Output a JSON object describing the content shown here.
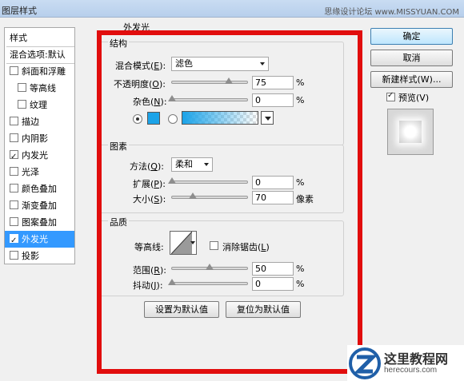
{
  "window": {
    "title": "图层样式",
    "watermark": "思缘设计论坛 www.MISSYUAN.COM"
  },
  "sidebar": {
    "items": [
      {
        "label": "样式",
        "checkbox": false,
        "checked": false,
        "selected": false,
        "indent": false
      },
      {
        "label": "混合选项:默认",
        "checkbox": false,
        "checked": false,
        "selected": false,
        "indent": false
      },
      {
        "label": "斜面和浮雕",
        "checkbox": true,
        "checked": false,
        "selected": false,
        "indent": false
      },
      {
        "label": "等高线",
        "checkbox": true,
        "checked": false,
        "selected": false,
        "indent": true
      },
      {
        "label": "纹理",
        "checkbox": true,
        "checked": false,
        "selected": false,
        "indent": true
      },
      {
        "label": "描边",
        "checkbox": true,
        "checked": false,
        "selected": false,
        "indent": false
      },
      {
        "label": "内阴影",
        "checkbox": true,
        "checked": false,
        "selected": false,
        "indent": false
      },
      {
        "label": "内发光",
        "checkbox": true,
        "checked": true,
        "selected": false,
        "indent": false
      },
      {
        "label": "光泽",
        "checkbox": true,
        "checked": false,
        "selected": false,
        "indent": false
      },
      {
        "label": "颜色叠加",
        "checkbox": true,
        "checked": false,
        "selected": false,
        "indent": false
      },
      {
        "label": "渐变叠加",
        "checkbox": true,
        "checked": false,
        "selected": false,
        "indent": false
      },
      {
        "label": "图案叠加",
        "checkbox": true,
        "checked": false,
        "selected": false,
        "indent": false
      },
      {
        "label": "外发光",
        "checkbox": true,
        "checked": true,
        "selected": true,
        "indent": false
      },
      {
        "label": "投影",
        "checkbox": true,
        "checked": false,
        "selected": false,
        "indent": false
      }
    ]
  },
  "panel": {
    "title": "外发光",
    "structure": {
      "title": "结构",
      "blend_mode_label": "混合模式(",
      "blend_mode_key": "E",
      "blend_mode_value": "滤色",
      "opacity_label": "不透明度(",
      "opacity_key": "O",
      "opacity_value": "75",
      "opacity_fraction": 0.75,
      "noise_label": "杂色(",
      "noise_key": "N",
      "noise_value": "0",
      "noise_fraction": 0,
      "color": "#1ba3e8"
    },
    "elements": {
      "title": "图素",
      "technique_label": "方法(",
      "technique_key": "Q",
      "technique_value": "柔和",
      "spread_label": "扩展(",
      "spread_key": "P",
      "spread_value": "0",
      "spread_fraction": 0,
      "size_label": "大小(",
      "size_key": "S",
      "size_value": "70",
      "size_unit": "像素",
      "size_fraction": 0.28
    },
    "quality": {
      "title": "品质",
      "contour_label": "等高线:",
      "antialias_label": "消除锯齿(",
      "antialias_key": "L",
      "range_label": "范围(",
      "range_key": "R",
      "range_value": "50",
      "range_fraction": 0.5,
      "jitter_label": "抖动(",
      "jitter_key": "J",
      "jitter_value": "0",
      "jitter_fraction": 0
    },
    "percent": "%",
    "paren_close": ")",
    "paren_close_colon": "):",
    "set_default_label": "设置为默认值",
    "reset_default_label": "复位为默认值"
  },
  "buttons": {
    "ok": "确定",
    "cancel": "取消",
    "new_style": "新建样式(W)...",
    "preview_label": "预览(V)",
    "preview_checked": true
  },
  "logo": {
    "title": "这里教程网",
    "url": "herecours.com"
  }
}
